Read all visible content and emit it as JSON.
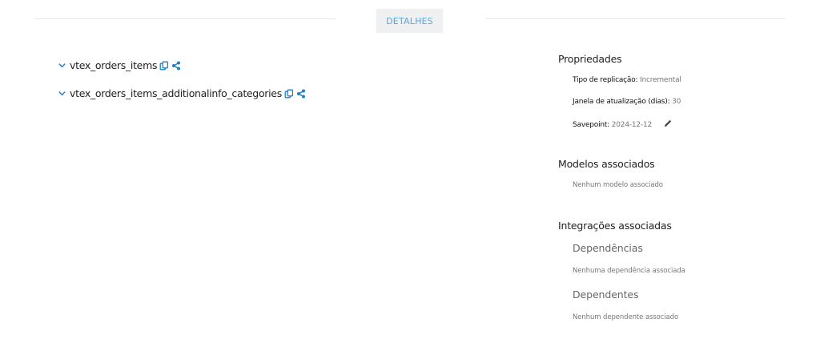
{
  "header": {
    "tab_label": "DETALHES"
  },
  "tree": {
    "items": [
      {
        "label": "vtex_orders_items"
      },
      {
        "label": "vtex_orders_items_additionalinfo_categories"
      }
    ]
  },
  "properties": {
    "title": "Propriedades",
    "replication_label": "Tipo de replicação:",
    "replication_value": "Incremental",
    "window_label": "Janela de atualização (dias):",
    "window_value": "30",
    "savepoint_label": "Savepoint:",
    "savepoint_value": "2024-12-12"
  },
  "models": {
    "title": "Modelos associados",
    "empty_text": "Nenhum modelo associado"
  },
  "integrations": {
    "title": "Integrações associadas",
    "dependencies_title": "Dependências",
    "dependencies_empty": "Nenhuma dependência associada",
    "dependents_title": "Dependentes",
    "dependents_empty": "Nenhum dependente associado"
  },
  "colors": {
    "accent": "#1f7fc4",
    "tab_bg": "#eef0f2",
    "tab_text": "#5aa7d6"
  },
  "icons": [
    "chevron-down-icon",
    "copy-icon",
    "share-icon",
    "pencil-icon"
  ]
}
